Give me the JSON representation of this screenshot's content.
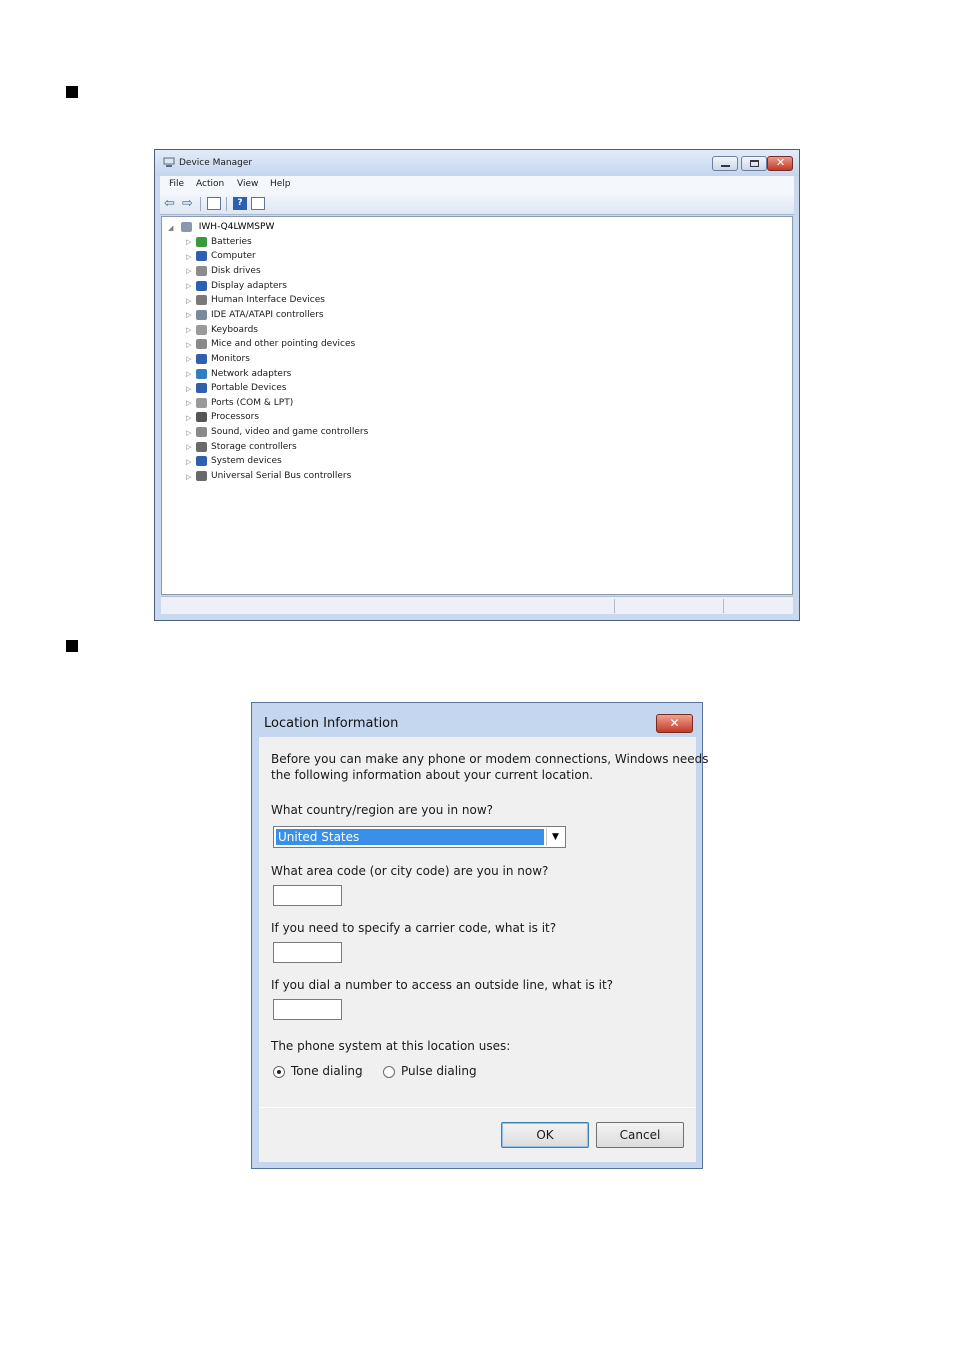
{
  "device_manager": {
    "title": "Device Manager",
    "menu": [
      "File",
      "Action",
      "View",
      "Help"
    ],
    "toolbar_icons": [
      "back-arrow-icon",
      "forward-arrow-icon",
      "properties-icon",
      "help-icon",
      "view-icon"
    ],
    "tree": {
      "root": "IWH-Q4LWMSPW",
      "items": [
        {
          "label": "Batteries",
          "icon": "battery-icon",
          "color": "#3a9a3a"
        },
        {
          "label": "Computer",
          "icon": "computer-icon",
          "color": "#2f5fb0"
        },
        {
          "label": "Disk drives",
          "icon": "disk-drive-icon",
          "color": "#8c8c8c"
        },
        {
          "label": "Display adapters",
          "icon": "display-adapter-icon",
          "color": "#2f5fb0"
        },
        {
          "label": "Human Interface Devices",
          "icon": "hid-icon",
          "color": "#7a7a7a"
        },
        {
          "label": "IDE ATA/ATAPI controllers",
          "icon": "ide-controller-icon",
          "color": "#7a8a9a"
        },
        {
          "label": "Keyboards",
          "icon": "keyboard-icon",
          "color": "#9a9a9a"
        },
        {
          "label": "Mice and other pointing devices",
          "icon": "mouse-icon",
          "color": "#8a8a8a"
        },
        {
          "label": "Monitors",
          "icon": "monitor-icon",
          "color": "#2f5fb0"
        },
        {
          "label": "Network adapters",
          "icon": "network-adapter-icon",
          "color": "#2f7fc0"
        },
        {
          "label": "Portable Devices",
          "icon": "portable-device-icon",
          "color": "#2f5fb0"
        },
        {
          "label": "Ports (COM & LPT)",
          "icon": "port-icon",
          "color": "#9a9a9a"
        },
        {
          "label": "Processors",
          "icon": "processor-icon",
          "color": "#555555"
        },
        {
          "label": "Sound, video and game controllers",
          "icon": "sound-icon",
          "color": "#8a8a8a"
        },
        {
          "label": "Storage controllers",
          "icon": "storage-controller-icon",
          "color": "#6a6a6a"
        },
        {
          "label": "System devices",
          "icon": "system-device-icon",
          "color": "#2f5fb0"
        },
        {
          "label": "Universal Serial Bus controllers",
          "icon": "usb-icon",
          "color": "#6a6a6a"
        }
      ]
    }
  },
  "location_dialog": {
    "title": "Location Information",
    "intro_line1": "Before you can make any phone or modem connections, Windows needs",
    "intro_line2": "the following information about your current location.",
    "country_question": "What country/region are you in now?",
    "country_value": "United States",
    "area_code_question": "What area code (or city code) are you in now?",
    "area_code_value": "",
    "carrier_question": "If you need to specify a carrier code, what is it?",
    "carrier_value": "",
    "outside_line_question": "If you dial a number to access an outside line, what is it?",
    "outside_line_value": "",
    "phone_system_question": "The phone system at this location uses:",
    "radio_options": {
      "tone": "Tone dialing",
      "pulse": "Pulse dialing"
    },
    "selected_dialing": "tone",
    "ok_label": "OK",
    "cancel_label": "Cancel",
    "selection_color": "#3a8fe8"
  }
}
